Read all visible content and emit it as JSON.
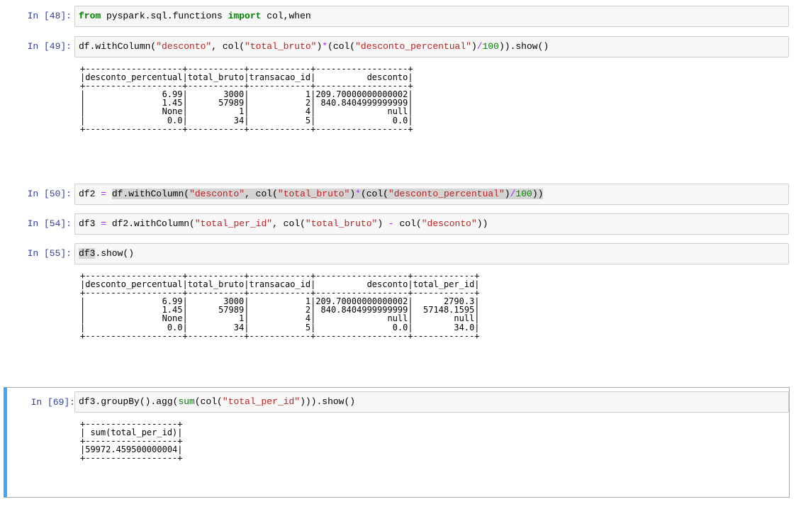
{
  "cells": [
    {
      "prompt": "In [48]:",
      "code_tokens": [
        {
          "t": "from",
          "c": "kw"
        },
        {
          "t": " pyspark.sql.functions "
        },
        {
          "t": "import",
          "c": "kw"
        },
        {
          "t": " col,when"
        }
      ],
      "output": ""
    },
    {
      "prompt": "In [49]:",
      "code_tokens": [
        {
          "t": "df.withColumn("
        },
        {
          "t": "\"desconto\"",
          "c": "str"
        },
        {
          "t": ", col("
        },
        {
          "t": "\"total_bruto\"",
          "c": "str"
        },
        {
          "t": ")"
        },
        {
          "t": "*",
          "c": "op"
        },
        {
          "t": "(col("
        },
        {
          "t": "\"desconto_percentual\"",
          "c": "str"
        },
        {
          "t": ")"
        },
        {
          "t": "/",
          "c": "op"
        },
        {
          "t": "100",
          "c": "num"
        },
        {
          "t": ")).show()"
        }
      ],
      "output": "+-------------------+-----------+------------+------------------+\n|desconto_percentual|total_bruto|transacao_id|          desconto|\n+-------------------+-----------+------------+------------------+\n|               6.99|       3000|           1|209.70000000000002|\n|               1.45|      57989|           2| 840.8404999999999|\n|               None|          1|           4|              null|\n|                0.0|         34|           5|               0.0|\n+-------------------+-----------+------------+------------------+"
    },
    {
      "prompt": "In [50]:",
      "code_tokens": [
        {
          "t": "df2 "
        },
        {
          "t": "=",
          "c": "op"
        },
        {
          "t": " "
        },
        {
          "t": "df.withColumn(",
          "c": "hl"
        },
        {
          "t": "\"desconto\"",
          "c": "str hl"
        },
        {
          "t": ", col(",
          "c": "hl"
        },
        {
          "t": "\"total_bruto\"",
          "c": "str hl"
        },
        {
          "t": ")",
          "c": "hl"
        },
        {
          "t": "*",
          "c": "op hl"
        },
        {
          "t": "(col(",
          "c": "hl"
        },
        {
          "t": "\"desconto_percentual\"",
          "c": "str hl"
        },
        {
          "t": ")",
          "c": "hl"
        },
        {
          "t": "/",
          "c": "op hl"
        },
        {
          "t": "100",
          "c": "num hl"
        },
        {
          "t": "))",
          "c": "hl"
        }
      ],
      "output": ""
    },
    {
      "prompt": "In [54]:",
      "code_tokens": [
        {
          "t": "df3 "
        },
        {
          "t": "=",
          "c": "op"
        },
        {
          "t": " df2.withColumn("
        },
        {
          "t": "\"total_per_id\"",
          "c": "str"
        },
        {
          "t": ", col("
        },
        {
          "t": "\"total_bruto\"",
          "c": "str"
        },
        {
          "t": ") "
        },
        {
          "t": "-",
          "c": "op"
        },
        {
          "t": " col("
        },
        {
          "t": "\"desconto\"",
          "c": "str"
        },
        {
          "t": "))"
        }
      ],
      "output": ""
    },
    {
      "prompt": "In [55]:",
      "code_tokens": [
        {
          "t": "df3",
          "c": "hl"
        },
        {
          "t": ".show()"
        }
      ],
      "output": "+-------------------+-----------+------------+------------------+------------+\n|desconto_percentual|total_bruto|transacao_id|          desconto|total_per_id|\n+-------------------+-----------+------------+------------------+------------+\n|               6.99|       3000|           1|209.70000000000002|      2790.3|\n|               1.45|      57989|           2| 840.8404999999999|  57148.1595|\n|               None|          1|           4|              null|        null|\n|                0.0|         34|           5|               0.0|        34.0|\n+-------------------+-----------+------------+------------------+------------+"
    },
    {
      "prompt": "In [69]:",
      "code_tokens": [
        {
          "t": "df3.groupBy().agg("
        },
        {
          "t": "sum",
          "c": "bi"
        },
        {
          "t": "(col("
        },
        {
          "t": "\"total_per_id\"",
          "c": "str"
        },
        {
          "t": "))).show()"
        }
      ],
      "output": "+------------------+\n| sum(total_per_id)|\n+------------------+\n|59972.459500000004|\n+------------------+"
    }
  ]
}
